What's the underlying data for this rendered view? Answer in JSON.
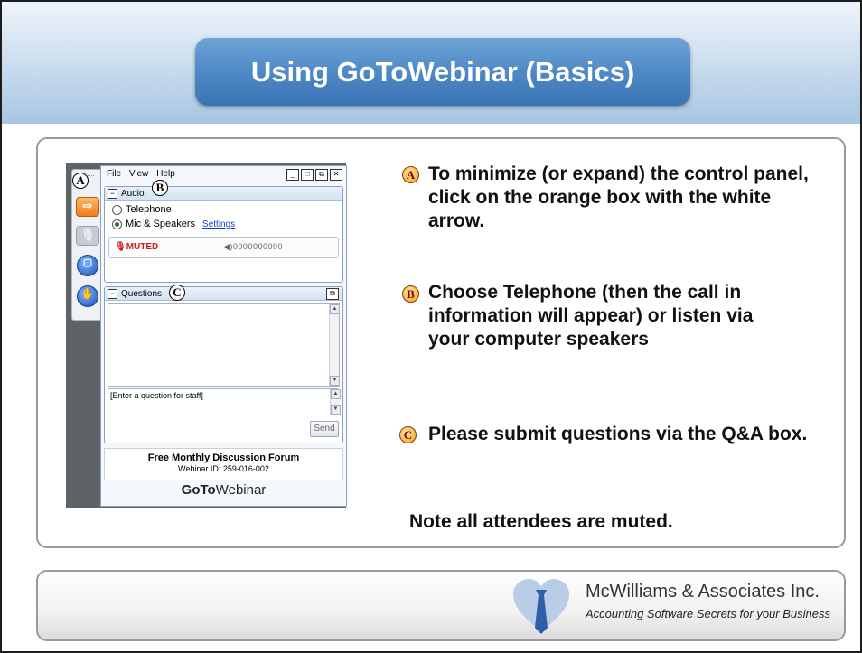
{
  "slide": {
    "title": "Using GoToWebinar (Basics)",
    "bullets": [
      {
        "marker": "A",
        "text": "To minimize (or expand) the control panel, click on the orange box with the white arrow."
      },
      {
        "marker": "B",
        "text": "Choose Telephone (then the call in information will appear) or listen via your computer speakers"
      },
      {
        "marker": "C",
        "text": "Please submit questions via the Q&A box."
      }
    ],
    "note": "Note all attendees are muted."
  },
  "gtw": {
    "menu": [
      "File",
      "View",
      "Help"
    ],
    "audio": {
      "header": "Audio",
      "option_telephone": "Telephone",
      "option_mic": "Mic & Speakers",
      "settings_link": "Settings",
      "status": "MUTED",
      "volume": "◀)0000000000"
    },
    "questions": {
      "header": "Questions",
      "input_placeholder": "[Enter a question for staff]",
      "send_label": "Send"
    },
    "forum_title": "Free Monthly Discussion Forum",
    "webinar_id": "Webinar ID: 259-016-002",
    "brand_bold": "GoTo",
    "brand_rest": "Webinar",
    "callouts": [
      "A",
      "B",
      "C"
    ]
  },
  "footer": {
    "company": "McWilliams & Associates Inc.",
    "tagline": "Accounting Software Secrets for your Business"
  },
  "colors": {
    "title_bar": "#4f89c6",
    "muted_red": "#d11b1b",
    "orange_button": "#ef7d1e",
    "logo_blue": "#2f5fa8"
  }
}
